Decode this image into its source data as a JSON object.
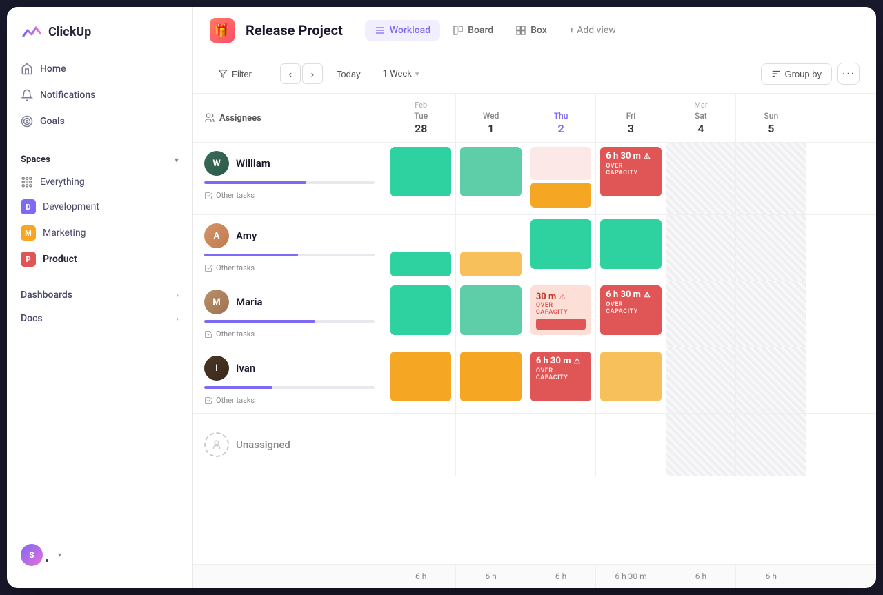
{
  "app": {
    "name": "ClickUp"
  },
  "sidebar": {
    "nav_items": [
      {
        "id": "home",
        "label": "Home",
        "icon": "🏠"
      },
      {
        "id": "notifications",
        "label": "Notifications",
        "icon": "🔔"
      },
      {
        "id": "goals",
        "label": "Goals",
        "icon": "🏆"
      }
    ],
    "spaces_label": "Spaces",
    "everything_label": "Everything",
    "spaces": [
      {
        "id": "development",
        "label": "Development",
        "letter": "D",
        "color": "#7c6af5"
      },
      {
        "id": "marketing",
        "label": "Marketing",
        "letter": "M",
        "color": "#f5a623"
      },
      {
        "id": "product",
        "label": "Product",
        "letter": "P",
        "color": "#e05555",
        "active": true
      }
    ],
    "dashboards_label": "Dashboards",
    "docs_label": "Docs",
    "user_initials": "S"
  },
  "header": {
    "project_title": "Release Project",
    "tabs": [
      {
        "id": "workload",
        "label": "Workload",
        "icon": "≡",
        "active": true
      },
      {
        "id": "board",
        "label": "Board",
        "icon": "⊞"
      },
      {
        "id": "box",
        "label": "Box",
        "icon": "⊡"
      }
    ],
    "add_view_label": "+ Add view"
  },
  "toolbar": {
    "filter_label": "Filter",
    "today_label": "Today",
    "week_label": "1 Week",
    "group_by_label": "Group by"
  },
  "grid": {
    "assignee_col_label": "Assignees",
    "days": [
      {
        "id": "tue",
        "month": "Feb",
        "name": "Tue",
        "num": "28",
        "today": false,
        "weekend": false
      },
      {
        "id": "wed",
        "month": "",
        "name": "Wed",
        "num": "1",
        "today": false,
        "weekend": false
      },
      {
        "id": "thu",
        "month": "",
        "name": "Thu",
        "num": "2",
        "today": true,
        "weekend": false
      },
      {
        "id": "fri",
        "month": "",
        "name": "Fri",
        "num": "3",
        "today": false,
        "weekend": false
      },
      {
        "id": "sat",
        "month": "Mar",
        "name": "Sat",
        "num": "4",
        "today": false,
        "weekend": true
      },
      {
        "id": "sun",
        "month": "",
        "name": "Sun",
        "num": "5",
        "today": false,
        "weekend": true
      }
    ],
    "assignees": [
      {
        "id": "william",
        "name": "William",
        "progress": 60,
        "progress_color": "#7c6af5",
        "other_tasks_label": "Other tasks",
        "days": [
          {
            "blocks": [
              {
                "color": "green",
                "height": 2
              }
            ],
            "secondary": []
          },
          {
            "blocks": [
              {
                "color": "light-green",
                "height": 2
              }
            ],
            "secondary": []
          },
          {
            "blocks": [
              {
                "color": "pink-light",
                "height": 1.5
              }
            ],
            "secondary": [
              {
                "color": "orange",
                "height": 1
              }
            ]
          },
          {
            "blocks": [
              {
                "color": "over-capacity",
                "label": "6 h 30 m",
                "cap": "OVER CAPACITY"
              }
            ],
            "secondary": []
          },
          {
            "blocks": [],
            "secondary": [],
            "weekend": true
          },
          {
            "blocks": [],
            "secondary": [],
            "weekend": true
          }
        ]
      },
      {
        "id": "amy",
        "name": "Amy",
        "progress": 55,
        "progress_color": "#7c6af5",
        "other_tasks_label": "Other tasks",
        "days": [
          {
            "blocks": [],
            "secondary": [
              {
                "color": "green",
                "height": 1
              }
            ]
          },
          {
            "blocks": [],
            "secondary": [
              {
                "color": "light-orange",
                "height": 0.6
              }
            ]
          },
          {
            "blocks": [
              {
                "color": "green",
                "height": 2
              }
            ],
            "secondary": []
          },
          {
            "blocks": [
              {
                "color": "green",
                "height": 2
              }
            ],
            "secondary": []
          },
          {
            "blocks": [],
            "secondary": [],
            "weekend": true
          },
          {
            "blocks": [],
            "secondary": [],
            "weekend": true
          }
        ]
      },
      {
        "id": "maria",
        "name": "Maria",
        "progress": 65,
        "progress_color": "#7c6af5",
        "other_tasks_label": "Other tasks",
        "days": [
          {
            "blocks": [
              {
                "color": "green",
                "height": 2
              }
            ],
            "secondary": []
          },
          {
            "blocks": [
              {
                "color": "light-green",
                "height": 2
              }
            ],
            "secondary": []
          },
          {
            "blocks": [
              {
                "color": "over-capacity-light",
                "label": "30 m",
                "cap": "OVER CAPACITY"
              }
            ],
            "secondary": []
          },
          {
            "blocks": [
              {
                "color": "over-capacity",
                "label": "6 h 30 m",
                "cap": "OVER CAPACITY"
              }
            ],
            "secondary": []
          },
          {
            "blocks": [],
            "secondary": [],
            "weekend": true
          },
          {
            "blocks": [],
            "secondary": [],
            "weekend": true
          }
        ]
      },
      {
        "id": "ivan",
        "name": "Ivan",
        "progress": 40,
        "progress_color": "#7c6af5",
        "other_tasks_label": "Other tasks",
        "days": [
          {
            "blocks": [
              {
                "color": "orange",
                "height": 2
              }
            ],
            "secondary": []
          },
          {
            "blocks": [
              {
                "color": "orange",
                "height": 2
              }
            ],
            "secondary": []
          },
          {
            "blocks": [
              {
                "color": "over-capacity",
                "label": "6 h 30 m",
                "cap": "OVER CAPACITY"
              }
            ],
            "secondary": []
          },
          {
            "blocks": [
              {
                "color": "light-orange",
                "height": 2
              }
            ],
            "secondary": []
          },
          {
            "blocks": [],
            "secondary": [],
            "weekend": true
          },
          {
            "blocks": [],
            "secondary": [],
            "weekend": true
          }
        ]
      }
    ],
    "unassigned_label": "Unassigned",
    "hours_row": [
      "",
      "6 h",
      "6 h",
      "6 h",
      "6 h 30 m",
      "6 h",
      "6 h"
    ]
  }
}
